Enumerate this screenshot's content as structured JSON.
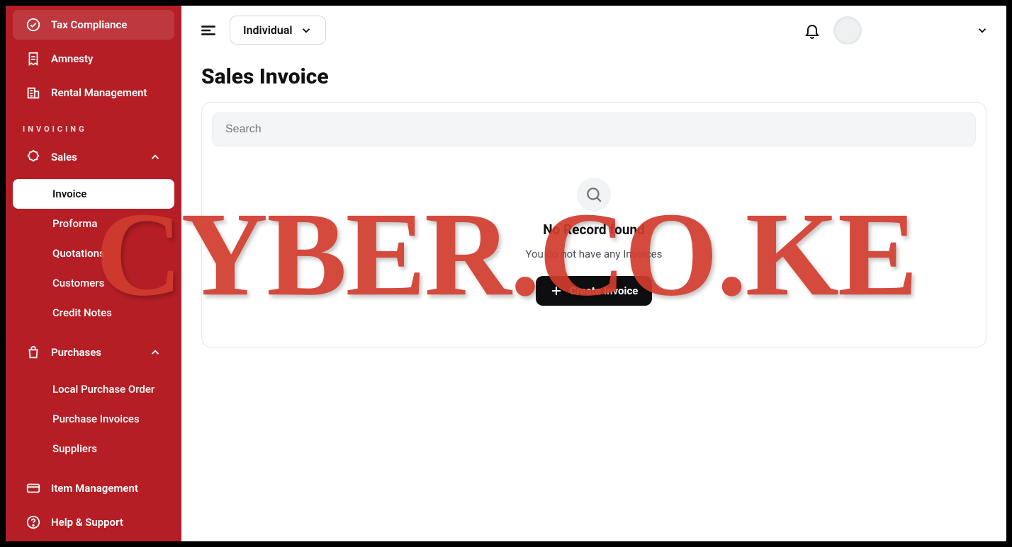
{
  "sidebar": {
    "taxCompliance": "Tax Compliance",
    "amnesty": "Amnesty",
    "rentalManagement": "Rental Management",
    "sectionInvoicing": "INVOICING",
    "sales": {
      "label": "Sales",
      "items": {
        "invoice": "Invoice",
        "proforma": "Proforma",
        "quotations": "Quotations",
        "customers": "Customers",
        "creditNotes": "Credit Notes"
      }
    },
    "purchases": {
      "label": "Purchases",
      "items": {
        "lpo": "Local Purchase Order",
        "purchaseInvoices": "Purchase Invoices",
        "suppliers": "Suppliers"
      }
    },
    "itemManagement": "Item Management",
    "helpSupport": "Help & Support"
  },
  "topbar": {
    "accountType": "Individual",
    "userLine1": "",
    "userLine2": ""
  },
  "page": {
    "title": "Sales Invoice",
    "searchPlaceholder": "Search",
    "emptyTitle": "No Record found",
    "emptySubtitle": "You do not have any Invoices",
    "createButton": "Create Invoice"
  },
  "watermark": "CYBER.CO.KE"
}
